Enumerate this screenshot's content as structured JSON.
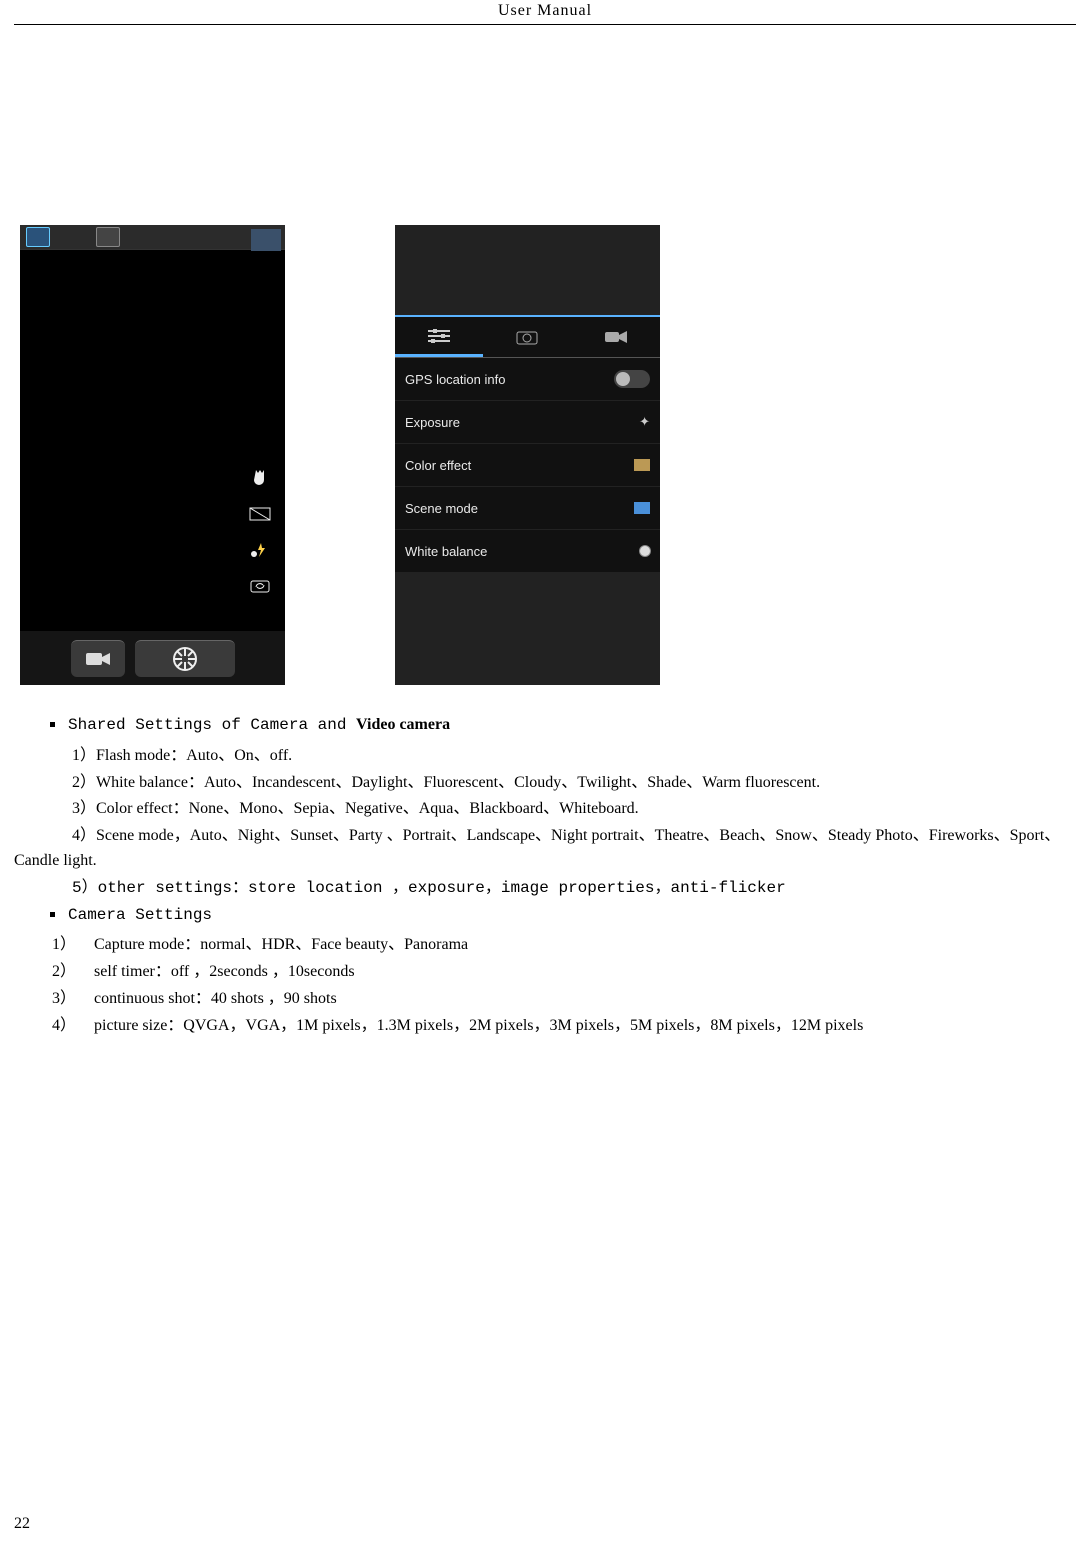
{
  "header": "User  Manual",
  "pageNumber": "22",
  "screenshot_left": {
    "side_icons": [
      "hand-icon",
      "hdr-icon",
      "flash-icon",
      "switch-camera-icon"
    ],
    "bottom_buttons": [
      "video-record-button",
      "shutter-button"
    ]
  },
  "screenshot_right": {
    "tabs": [
      "settings-sliders-icon",
      "camera-icon",
      "video-icon"
    ],
    "settings": [
      {
        "label": "GPS location info",
        "type": "toggle"
      },
      {
        "label": "Exposure",
        "icon": "exposure"
      },
      {
        "label": "Color effect",
        "icon": "coloreffect"
      },
      {
        "label": "Scene mode",
        "icon": "scene"
      },
      {
        "label": "White balance",
        "icon": "wb"
      }
    ]
  },
  "content": {
    "shared_heading_mono": "Shared Settings of Camera and ",
    "shared_heading_bold": "Video camera",
    "shared_items": [
      "1）Flash mode：Auto、On、off.",
      "2）White balance：Auto、Incandescent、Daylight、Fluorescent、Cloudy、Twilight、Shade、Warm fluorescent.",
      "3）Color effect：None、Mono、Sepia、Negative、Aqua、Blackboard、Whiteboard.",
      "4）Scene mode，Auto、Night、Sunset、Party 、Portrait、Landscape、Night portrait、Theatre、Beach、Snow、Steady Photo、Fireworks、Sport、Candle light."
    ],
    "shared_item5": "5）other settings：store location ，exposure，image properties，anti-flicker",
    "cam_heading": "Camera Settings",
    "cam_items": [
      {
        "num": "1）",
        "text": "Capture mode：normal、HDR、Face beauty、Panorama"
      },
      {
        "num": "2）",
        "text": "self timer：off ，2seconds ，10seconds"
      },
      {
        "num": "3）",
        "text": "continuous shot：40 shots ，90 shots"
      },
      {
        "num": "4）",
        "text": "picture size：QVGA，VGA，1M pixels，1.3M pixels，2M pixels，3M pixels，5M pixels，8M pixels，12M pixels"
      }
    ]
  }
}
